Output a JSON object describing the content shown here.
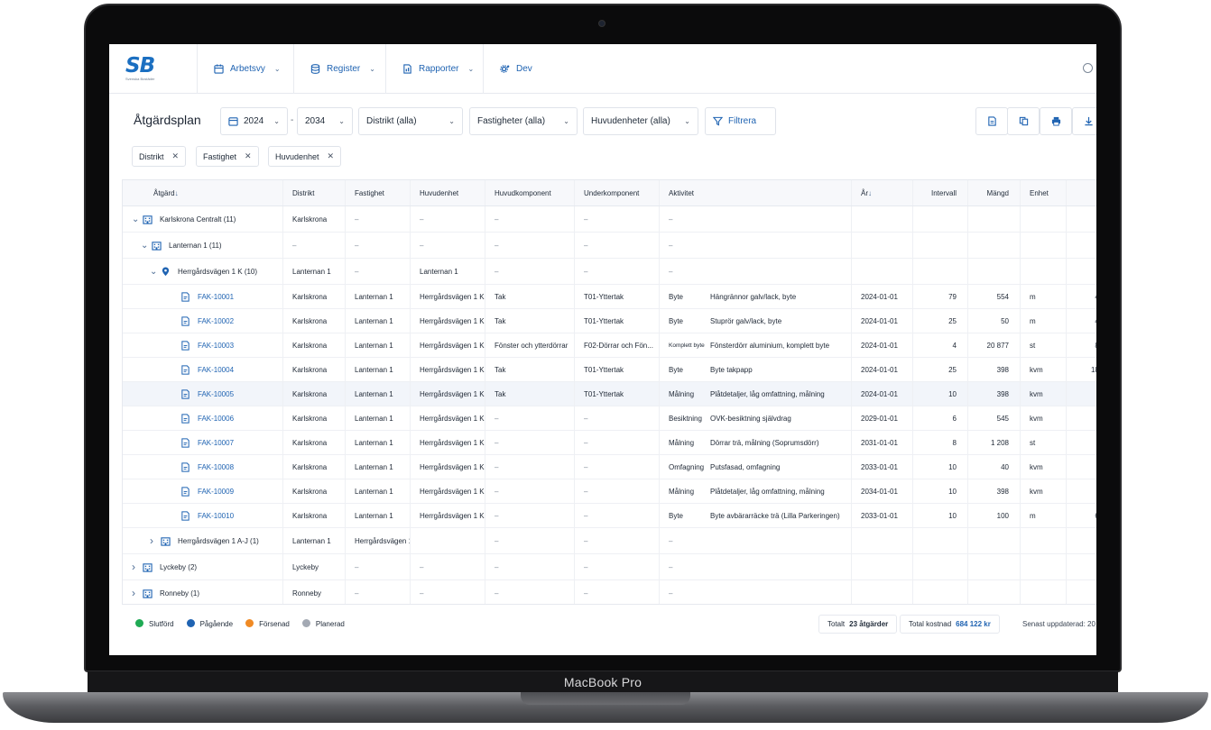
{
  "device": {
    "label": "MacBook Pro"
  },
  "app": {
    "logo_text": "SB",
    "logo_subtext": "Svenska Bostäder",
    "nav": [
      {
        "label": "Arbetsvy",
        "icon": "calendar-icon"
      },
      {
        "label": "Register",
        "icon": "database-icon"
      },
      {
        "label": "Rapporter",
        "icon": "report-icon"
      },
      {
        "label": "Dev",
        "icon": "gear-icon"
      }
    ]
  },
  "toolbar": {
    "title": "Åtgärdsplan",
    "year_from": "2024",
    "year_to": "2034",
    "range_sep": "-",
    "district": "Distrikt (alla)",
    "properties": "Fastigheter (alla)",
    "main_units": "Huvudenheter (alla)",
    "filter_label": "Filtrera"
  },
  "chips": [
    "Distrikt",
    "Fastighet",
    "Huvudenhet"
  ],
  "columns": {
    "atgard": "Åtgärd",
    "distrikt": "Distrikt",
    "fastighet": "Fastighet",
    "huvudenhet": "Huvudenhet",
    "huvudkomponent": "Huvudkomponent",
    "underkomponent": "Underkomponent",
    "aktivitet": "Aktivitet",
    "ar": "År",
    "intervall": "Intervall",
    "mangd": "Mängd",
    "enhet": "Enhet",
    "kostnad": "Kos"
  },
  "groups": [
    {
      "label": "Karlskrona Centralt (11)",
      "distrikt": "Karlskrona",
      "fastighet": "–",
      "huvudenhet": "–",
      "huvudkomponent": "–",
      "underkomponent": "–",
      "aktivitet": "–"
    },
    {
      "label": "Lanternan 1 (11)",
      "distrikt": "–",
      "fastighet": "–",
      "huvudenhet": "–",
      "huvudkomponent": "–",
      "underkomponent": "–",
      "aktivitet": "–"
    },
    {
      "label": "Herrgårdsvägen 1 K (10)",
      "distrikt": "Lanternan 1",
      "fastighet": "–",
      "huvudenhet": "Lanternan 1",
      "huvudkomponent": "–",
      "underkomponent": "–",
      "aktivitet": "–"
    }
  ],
  "rows": [
    {
      "id": "FAK-10001",
      "distrikt": "Karlskrona",
      "fastighet": "Lanternan 1",
      "huvudenhet": "Herrgårdsvägen 1 K",
      "huvudkomponent": "Tak",
      "underkomponent": "T01-Yttertak",
      "typ": "Byte",
      "aktivitet": "Hängrännor galv/lack, byte",
      "ar": "2024-01-01",
      "intervall": "79",
      "mangd": "554",
      "enhet": "m",
      "kostnad": "43 7"
    },
    {
      "id": "FAK-10002",
      "distrikt": "Karlskrona",
      "fastighet": "Lanternan 1",
      "huvudenhet": "Herrgårdsvägen 1 K",
      "huvudkomponent": "Tak",
      "underkomponent": "T01-Yttertak",
      "typ": "Byte",
      "aktivitet": "Stuprör galv/lack, byte",
      "ar": "2024-01-01",
      "intervall": "25",
      "mangd": "50",
      "enhet": "m",
      "kostnad": "44 3"
    },
    {
      "id": "FAK-10003",
      "distrikt": "Karlskrona",
      "fastighet": "Lanternan 1",
      "huvudenhet": "Herrgårdsvägen 1 K",
      "huvudkomponent": "Fönster och ytterdörrar",
      "underkomponent": "F02-Dörrar och Fön...",
      "typ": "Komplett byte",
      "aktivitet": "Fönsterdörr aluminium, komplett byte",
      "ar": "2024-01-01",
      "intervall": "4",
      "mangd": "20 877",
      "enhet": "st",
      "kostnad": "83 5"
    },
    {
      "id": "FAK-10004",
      "distrikt": "Karlskrona",
      "fastighet": "Lanternan 1",
      "huvudenhet": "Herrgårdsvägen 1 K",
      "huvudkomponent": "Tak",
      "underkomponent": "T01-Yttertak",
      "typ": "Byte",
      "aktivitet": "Byte takpapp",
      "ar": "2024-01-01",
      "intervall": "25",
      "mangd": "398",
      "enhet": "kvm",
      "kostnad": "182 6"
    },
    {
      "id": "FAK-10005",
      "distrikt": "Karlskrona",
      "fastighet": "Lanternan 1",
      "huvudenhet": "Herrgårdsvägen 1 K",
      "huvudkomponent": "Tak",
      "underkomponent": "T01-Yttertak",
      "typ": "Målning",
      "aktivitet": "Plåtdetaljer, låg omfattning, målning",
      "ar": "2024-01-01",
      "intervall": "10",
      "mangd": "398",
      "enhet": "kvm",
      "kostnad": "5 3"
    },
    {
      "id": "FAK-10006",
      "distrikt": "Karlskrona",
      "fastighet": "Lanternan 1",
      "huvudenhet": "Herrgårdsvägen 1 K",
      "huvudkomponent": "–",
      "underkomponent": "–",
      "typ": "Besiktning",
      "aktivitet": "OVK-besiktning självdrag",
      "ar": "2029-01-01",
      "intervall": "6",
      "mangd": "545",
      "enhet": "kvm",
      "kostnad": "4 4"
    },
    {
      "id": "FAK-10007",
      "distrikt": "Karlskrona",
      "fastighet": "Lanternan 1",
      "huvudenhet": "Herrgårdsvägen 1 K",
      "huvudkomponent": "–",
      "underkomponent": "–",
      "typ": "Målning",
      "aktivitet": "Dörrar trä, målning (Soprumsdörr)",
      "ar": "2031-01-01",
      "intervall": "8",
      "mangd": "1 208",
      "enhet": "st",
      "kostnad": "1 2"
    },
    {
      "id": "FAK-10008",
      "distrikt": "Karlskrona",
      "fastighet": "Lanternan 1",
      "huvudenhet": "Herrgårdsvägen 1 K",
      "huvudkomponent": "–",
      "underkomponent": "–",
      "typ": "Omfagning",
      "aktivitet": "Putsfasad, omfagning",
      "ar": "2033-01-01",
      "intervall": "10",
      "mangd": "40",
      "enhet": "kvm",
      "kostnad": "7 5"
    },
    {
      "id": "FAK-10009",
      "distrikt": "Karlskrona",
      "fastighet": "Lanternan 1",
      "huvudenhet": "Herrgårdsvägen 1 K",
      "huvudkomponent": "–",
      "underkomponent": "–",
      "typ": "Målning",
      "aktivitet": "Plåtdetaljer, låg omfattning, målning",
      "ar": "2034-01-01",
      "intervall": "10",
      "mangd": "398",
      "enhet": "kvm",
      "kostnad": "5 3"
    },
    {
      "id": "FAK-10010",
      "distrikt": "Karlskrona",
      "fastighet": "Lanternan 1",
      "huvudenhet": "Herrgårdsvägen 1 K",
      "huvudkomponent": "–",
      "underkomponent": "–",
      "typ": "Byte",
      "aktivitet": "Byte avbärarräcke trä (Lilla Parkeringen)",
      "ar": "2033-01-01",
      "intervall": "10",
      "mangd": "100",
      "enhet": "m",
      "kostnad": "65 8"
    }
  ],
  "tail_groups": [
    {
      "label": "Herrgårdsvägen 1 A-J (1)",
      "distrikt": "Lanternan 1",
      "fastighet": "Herrgårdsvägen 1 A-J",
      "huvudenhet": "",
      "huvudkomponent": "–",
      "underkomponent": "–",
      "aktivitet": "–"
    },
    {
      "label": "Lyckeby (2)",
      "distrikt": "Lyckeby",
      "fastighet": "–",
      "huvudenhet": "–",
      "huvudkomponent": "–",
      "underkomponent": "–",
      "aktivitet": "–"
    },
    {
      "label": "Ronneby (1)",
      "distrikt": "Ronneby",
      "fastighet": "–",
      "huvudenhet": "–",
      "huvudkomponent": "–",
      "underkomponent": "–",
      "aktivitet": "–"
    }
  ],
  "legend": [
    {
      "label": "Slutförd",
      "color": "#1faa54"
    },
    {
      "label": "Pågående",
      "color": "#1f63b2"
    },
    {
      "label": "Försenad",
      "color": "#f08a24"
    },
    {
      "label": "Planerad",
      "color": "#a3a9b3"
    }
  ],
  "footer": {
    "total_label": "Totalt",
    "total_value": "23 åtgärder",
    "cost_label": "Total kostnad",
    "cost_value": "684 122 kr",
    "updated": "Senast uppdaterad: 20"
  }
}
